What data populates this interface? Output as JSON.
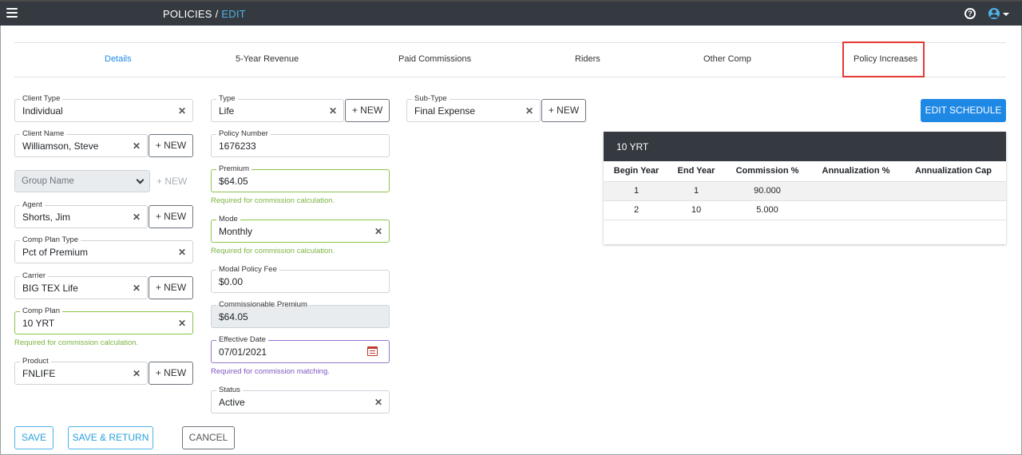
{
  "header": {
    "breadcrumb_root": "POLICIES",
    "breadcrumb_sep": "/",
    "breadcrumb_current": "EDIT"
  },
  "tabs": [
    {
      "label": "Details",
      "active": true
    },
    {
      "label": "5-Year Revenue"
    },
    {
      "label": "Paid Commissions"
    },
    {
      "label": "Riders"
    },
    {
      "label": "Other Comp"
    },
    {
      "label": "Policy Increases",
      "highlighted": true
    }
  ],
  "form": {
    "client_type": {
      "label": "Client Type",
      "value": "Individual"
    },
    "client_name": {
      "label": "Client Name",
      "value": "Williamson, Steve"
    },
    "group_name": {
      "placeholder": "Group Name"
    },
    "agent": {
      "label": "Agent",
      "value": "Shorts, Jim"
    },
    "comp_plan_type": {
      "label": "Comp Plan Type",
      "value": "Pct of Premium"
    },
    "carrier": {
      "label": "Carrier",
      "value": "BIG TEX Life"
    },
    "comp_plan": {
      "label": "Comp Plan",
      "value": "10 YRT",
      "hint": "Required for commission calculation."
    },
    "product": {
      "label": "Product",
      "value": "FNLIFE"
    },
    "type": {
      "label": "Type",
      "value": "Life"
    },
    "policy_number": {
      "label": "Policy Number",
      "value": "1676233"
    },
    "premium": {
      "label": "Premium",
      "value": "$64.05",
      "hint": "Required for commission calculation."
    },
    "mode": {
      "label": "Mode",
      "value": "Monthly",
      "hint": "Required for commission calculation."
    },
    "modal_policy_fee": {
      "label": "Modal Policy Fee",
      "value": "$0.00"
    },
    "commissionable_premium": {
      "label": "Commissionable Premium",
      "value": "$64.05"
    },
    "effective_date": {
      "label": "Effective Date",
      "value": "07/01/2021",
      "hint": "Required for commission matching."
    },
    "status": {
      "label": "Status",
      "value": "Active"
    },
    "sub_type": {
      "label": "Sub-Type",
      "value": "Final Expense"
    },
    "new_label": "+ NEW",
    "clear_glyph": "✕"
  },
  "buttons": {
    "save": "SAVE",
    "save_return": "SAVE & RETURN",
    "cancel": "CANCEL",
    "edit_schedule": "EDIT SCHEDULE"
  },
  "schedule": {
    "title": "10 YRT",
    "columns": [
      "Begin Year",
      "End Year",
      "Commission %",
      "Annualization %",
      "Annualization Cap"
    ],
    "rows": [
      [
        "1",
        "1",
        "90.000",
        "",
        ""
      ],
      [
        "2",
        "10",
        "5.000",
        "",
        ""
      ]
    ]
  },
  "colors": {
    "topbar": "#343a40",
    "accent": "#1e88e5",
    "valid": "#8bc34a",
    "highlight": "#e53935"
  }
}
